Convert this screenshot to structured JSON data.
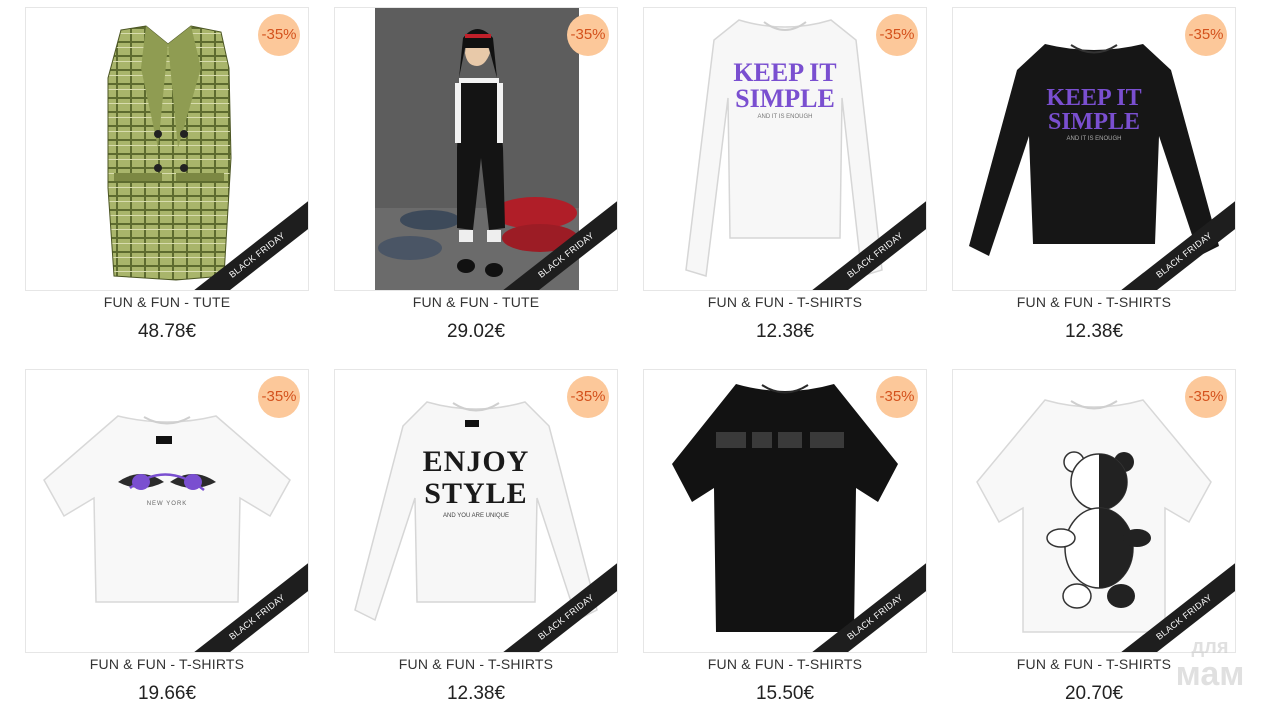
{
  "products": [
    {
      "name": "FUN & FUN - TUTE",
      "price": "48.78€",
      "discount": "-35%",
      "ribbon": "BLACK FRIDAY",
      "art": "plaid-vest-icon"
    },
    {
      "name": "FUN & FUN - TUTE",
      "price": "29.02€",
      "discount": "-35%",
      "ribbon": "BLACK FRIDAY",
      "art": "girl-photo"
    },
    {
      "name": "FUN & FUN - T-SHIRTS",
      "price": "12.38€",
      "discount": "-35%",
      "ribbon": "BLACK FRIDAY",
      "art": "white-longsleeve",
      "print_line1": "KEEP IT",
      "print_line2": "SIMPLE",
      "print_small": "AND IT IS ENOUGH"
    },
    {
      "name": "FUN & FUN - T-SHIRTS",
      "price": "12.38€",
      "discount": "-35%",
      "ribbon": "BLACK FRIDAY",
      "art": "black-longsleeve",
      "print_line1": "KEEP IT",
      "print_line2": "SIMPLE",
      "print_small": "AND IT IS ENOUGH"
    },
    {
      "name": "FUN & FUN - T-SHIRTS",
      "price": "19.66€",
      "discount": "-35%",
      "ribbon": "BLACK FRIDAY",
      "art": "white-tee-eyes",
      "print_small": "NEW YORK"
    },
    {
      "name": "FUN & FUN - T-SHIRTS",
      "price": "12.38€",
      "discount": "-35%",
      "ribbon": "BLACK FRIDAY",
      "art": "white-longsleeve-enjoy",
      "print_line1": "ENJOY",
      "print_line2": "STYLE",
      "print_small": "AND YOU ARE UNIQUE"
    },
    {
      "name": "FUN & FUN - T-SHIRTS",
      "price": "15.50€",
      "discount": "-35%",
      "ribbon": "BLACK FRIDAY",
      "art": "black-tee-sequin"
    },
    {
      "name": "FUN & FUN - T-SHIRTS",
      "price": "20.70€",
      "discount": "-35%",
      "ribbon": "BLACK FRIDAY",
      "art": "white-tee-bear"
    }
  ],
  "watermark": {
    "line1": "для",
    "line2": "мам"
  },
  "colors": {
    "badge_bg": "#fcc89a",
    "badge_text": "#d4521d",
    "ribbon_bg": "#1e1e1e",
    "print_purple": "#7a4fd0"
  }
}
